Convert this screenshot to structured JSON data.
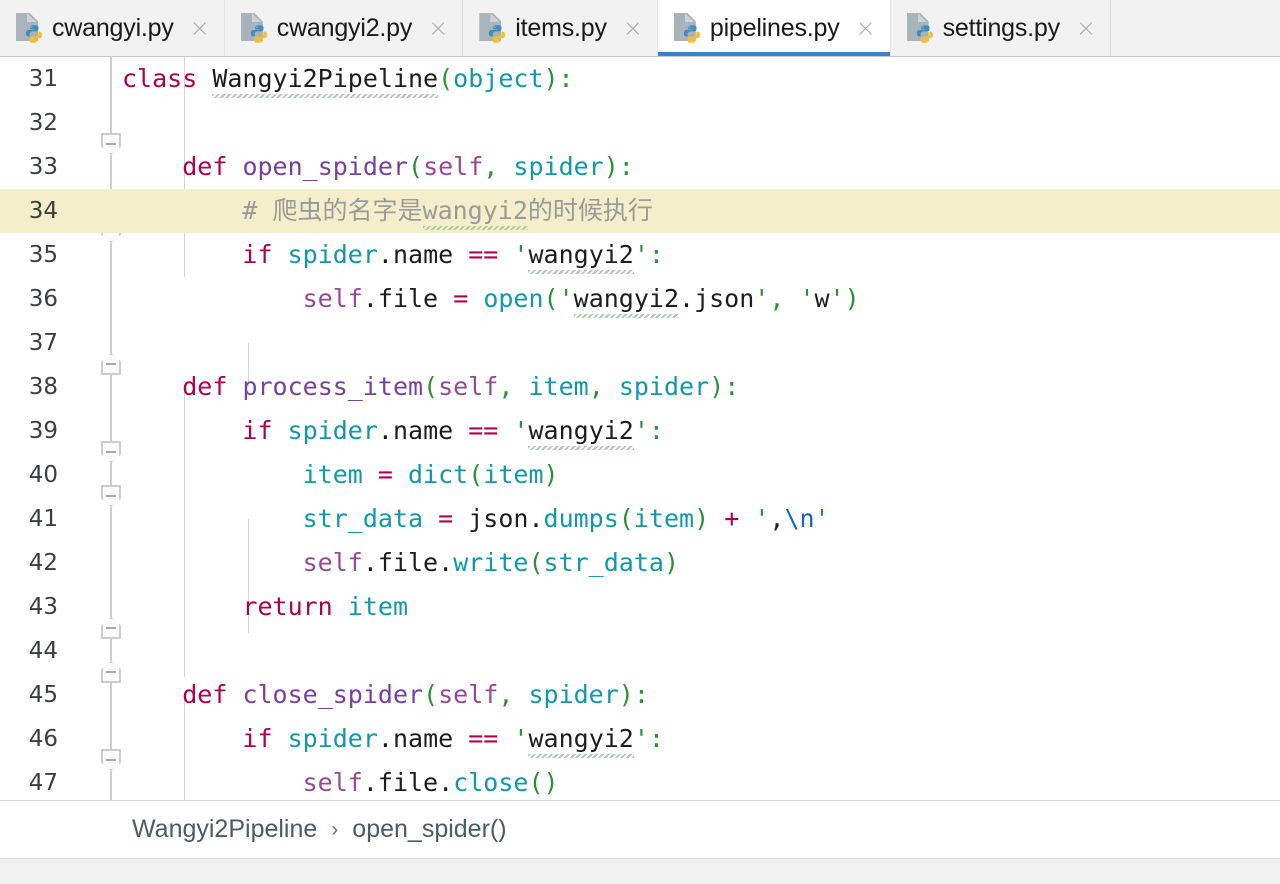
{
  "window": {
    "app": "PyCharm",
    "active_file": "pipelines.py"
  },
  "tabs": [
    {
      "label": "cwangyi.py",
      "icon": "python-file-icon",
      "close_icon": "×",
      "active": false
    },
    {
      "label": "cwangyi2.py",
      "icon": "python-file-icon",
      "close_icon": "×",
      "active": false
    },
    {
      "label": "items.py",
      "icon": "python-file-icon",
      "close_icon": "×",
      "active": false
    },
    {
      "label": "pipelines.py",
      "icon": "python-file-icon",
      "close_icon": "×",
      "active": true
    },
    {
      "label": "settings.py",
      "icon": "python-file-icon",
      "close_icon": "×",
      "active": false
    }
  ],
  "editor": {
    "first_line": 31,
    "highlighted_line": 34,
    "lines": [
      {
        "no": "31",
        "text": "class Wangyi2Pipeline(object):"
      },
      {
        "no": "32",
        "text": ""
      },
      {
        "no": "33",
        "text": "    def open_spider(self, spider):"
      },
      {
        "no": "34",
        "text": "        # 爬虫的名字是wangyi2的时候执行"
      },
      {
        "no": "35",
        "text": "        if spider.name == 'wangyi2':"
      },
      {
        "no": "36",
        "text": "            self.file = open('wangyi2.json', 'w')"
      },
      {
        "no": "37",
        "text": ""
      },
      {
        "no": "38",
        "text": "    def process_item(self, item, spider):"
      },
      {
        "no": "39",
        "text": "        if spider.name == 'wangyi2':"
      },
      {
        "no": "40",
        "text": "            item = dict(item)"
      },
      {
        "no": "41",
        "text": "            str_data = json.dumps(item) + ',\\n'"
      },
      {
        "no": "42",
        "text": "            self.file.write(str_data)"
      },
      {
        "no": "43",
        "text": "        return item"
      },
      {
        "no": "44",
        "text": ""
      },
      {
        "no": "45",
        "text": "    def close_spider(self, spider):"
      },
      {
        "no": "46",
        "text": "        if spider.name == 'wangyi2':"
      },
      {
        "no": "47",
        "text": "            self.file.close()"
      }
    ]
  },
  "breadcrumb": {
    "items": [
      "Wangyi2Pipeline",
      "open_spider()"
    ],
    "separator": "›"
  },
  "colors": {
    "keyword": "#b00050",
    "function": "#7a3fa0",
    "self": "#96499a",
    "parameter": "#1098ad",
    "string": "#2a9134",
    "comment": "#9b9b9b",
    "escape": "#1565c0",
    "highlight_line_bg": "#f5eeca",
    "active_tab_underline": "#3c7fcb",
    "tabbar_bg": "#f2f2f2",
    "editor_bg": "#ffffff",
    "breadcrumb_text": "#4a5b6b",
    "typo_squiggle": "#9ec89e"
  }
}
